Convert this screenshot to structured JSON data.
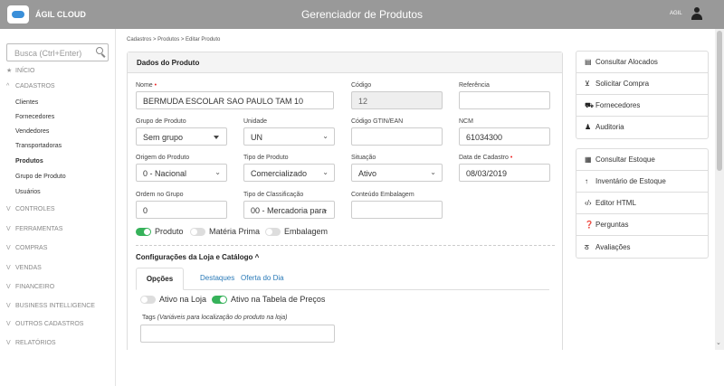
{
  "topbar": {
    "brand": "ÁGIL CLOUD",
    "title": "Gerenciador de Produtos",
    "user": "AGIL"
  },
  "sidebar": {
    "search_placeholder": "Busca (Ctrl+Enter)",
    "nav": {
      "inicio": "INÍCIO",
      "cadastros": "CADASTROS",
      "cadastros_items": [
        "Clientes",
        "Fornecedores",
        "Vendedores",
        "Transportadoras",
        "Produtos",
        "Grupo de Produto",
        "Usuários"
      ],
      "controles": "CONTROLES",
      "ferramentas": "FERRAMENTAS",
      "compras": "COMPRAS",
      "vendas": "VENDAS",
      "financeiro": "FINANCEIRO",
      "bi": "BUSINESS INTELLIGENCE",
      "outros": "OUTROS CADASTROS",
      "relatorios": "RELATÓRIOS"
    }
  },
  "breadcrumb": "Cadastros > Produtos > Editar Produto",
  "form": {
    "title": "Dados do Produto",
    "nome": {
      "label": "Nome",
      "value": "BERMUDA ESCOLAR SAO PAULO TAM 10"
    },
    "codigo": {
      "label": "Código",
      "value": "12"
    },
    "referencia": {
      "label": "Referência",
      "value": ""
    },
    "grupo": {
      "label": "Grupo de Produto",
      "value": "Sem grupo"
    },
    "unidade": {
      "label": "Unidade",
      "value": "UN"
    },
    "gtin": {
      "label": "Código GTIN/EAN",
      "value": ""
    },
    "ncm": {
      "label": "NCM",
      "value": "61034300"
    },
    "origem": {
      "label": "Origem do Produto",
      "value": "0 - Nacional"
    },
    "tipo": {
      "label": "Tipo de Produto",
      "value": "Comercializado"
    },
    "situacao": {
      "label": "Situação",
      "value": "Ativo"
    },
    "data_cadastro": {
      "label": "Data de Cadastro",
      "value": "08/03/2019"
    },
    "ordem": {
      "label": "Ordem no Grupo",
      "value": "0"
    },
    "classificacao": {
      "label": "Tipo de Classificação",
      "value": "00 - Mercadoria para"
    },
    "embalagem": {
      "label": "Conteúdo Embalagem",
      "value": ""
    },
    "toggles": {
      "produto": {
        "label": "Produto",
        "on": true
      },
      "materia": {
        "label": "Matéria Prima",
        "on": false
      },
      "embalagem": {
        "label": "Embalagem",
        "on": false
      }
    }
  },
  "loja": {
    "title": "Configurações da Loja e Catálogo ^",
    "tabs": [
      "Opções",
      "Destaques",
      "Oferta do Dia"
    ],
    "toggles": {
      "ativo_loja": {
        "label": "Ativo na Loja",
        "on": false
      },
      "ativo_precos": {
        "label": "Ativo na Tabela de Preços",
        "on": true
      }
    },
    "tags_label": "Tags",
    "tags_hint": "(Variáveis para localização do produto na loja)",
    "tags_value": ""
  },
  "right_menu_1": [
    "Consultar Alocados",
    "Solicitar Compra",
    "Fornecedores",
    "Auditoria"
  ],
  "right_menu_2": [
    "Consultar Estoque",
    "Inventário de Estoque",
    "Editor HTML",
    "Perguntas",
    "Avaliações"
  ]
}
